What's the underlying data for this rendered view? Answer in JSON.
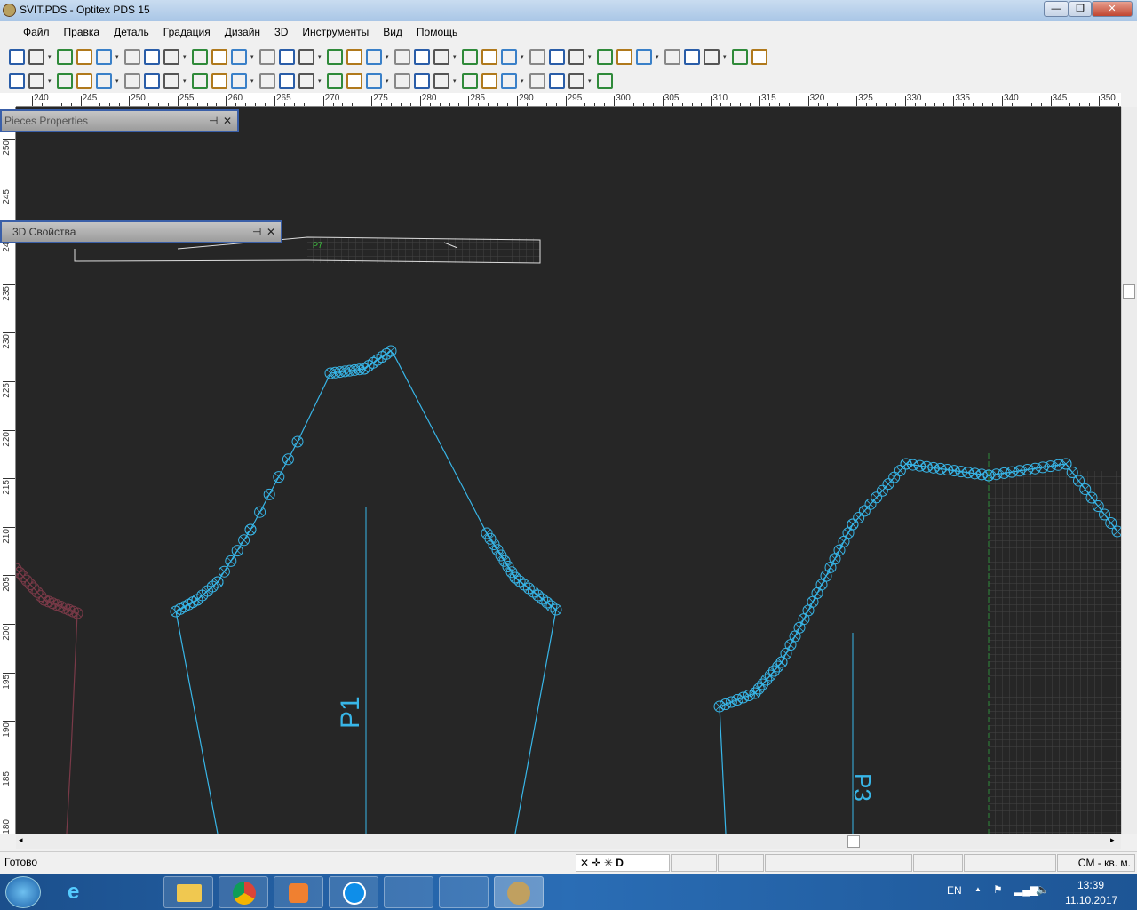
{
  "window": {
    "title": "SVIT.PDS - Optitex PDS 15",
    "minimize": "—",
    "maximize": "❐",
    "close": "✕"
  },
  "menu": [
    "Файл",
    "Правка",
    "Деталь",
    "Градация",
    "Дизайн",
    "3D",
    "Инструменты",
    "Вид",
    "Помощь"
  ],
  "toolbar_icons_row1": [
    "select-arrow-icon",
    "new-file-icon",
    "open-folder-icon",
    "save-icon",
    "print-icon",
    "plotter-icon",
    "layout-icon",
    "excel-icon",
    "tag-icon",
    "zoom-icon",
    "undo-icon",
    "redo-icon",
    "cut-icon",
    "copy-icon",
    "paste-icon",
    "import-icon",
    "help-icon",
    "measure-icon",
    "piece-icon",
    "points-icon",
    "grade-icon",
    "add-icon",
    "link-icon",
    "dart-icon",
    "cut-line-icon",
    "notch-icon",
    "pattern-icon",
    "circle-icon",
    "walk-icon",
    "ruler-icon",
    "3d-icon",
    "mirror-icon",
    "fold-icon",
    "shape-icon"
  ],
  "toolbar_icons_row2": [
    "add-point-icon",
    "perpendicular-icon",
    "sew-icon",
    "dart-tool-icon",
    "button-icon",
    "buttonhole-icon",
    "text-icon",
    "omega-icon",
    "pen-curve-icon",
    "lasso-icon",
    "curve-icon",
    "delete-icon",
    "pen-icon",
    "move-point-icon",
    "export-icon",
    "frame-icon",
    "rotate-icon",
    "refresh-icon",
    "rotate-left-icon",
    "rotate-right-icon",
    "stack-icon",
    "triangle-icon",
    "page-icon",
    "bucket-icon",
    "swap-icon",
    "copy-piece-icon",
    "list-icon"
  ],
  "ruler": {
    "top": [
      "240",
      "245",
      "250",
      "255",
      "260",
      "265",
      "270",
      "275",
      "280",
      "285",
      "290",
      "295",
      "300",
      "305",
      "310",
      "315",
      "320",
      "325",
      "330",
      "335",
      "340",
      "345",
      "350"
    ],
    "left": [
      "250",
      "245",
      "240",
      "235",
      "230",
      "225",
      "220",
      "215",
      "210",
      "205",
      "200",
      "195",
      "190",
      "185",
      "180"
    ]
  },
  "panels": {
    "pieces": {
      "title": "Pieces Properties"
    },
    "props3d": {
      "title": "3D Свойства"
    },
    "pin": "⊣",
    "close": "✕"
  },
  "pieces": {
    "p1": "P1",
    "p3": "P3",
    "p7": "P7"
  },
  "colors": {
    "canvas": "#262626",
    "piece": "#38b6e8",
    "piece_other": "#7a3a48",
    "p7_label": "#3ad23a"
  },
  "status": {
    "text": "Готово",
    "units": "CM - кв. м."
  },
  "taskbar": {
    "lang": "EN",
    "time": "13:39",
    "date": "11.10.2017"
  }
}
